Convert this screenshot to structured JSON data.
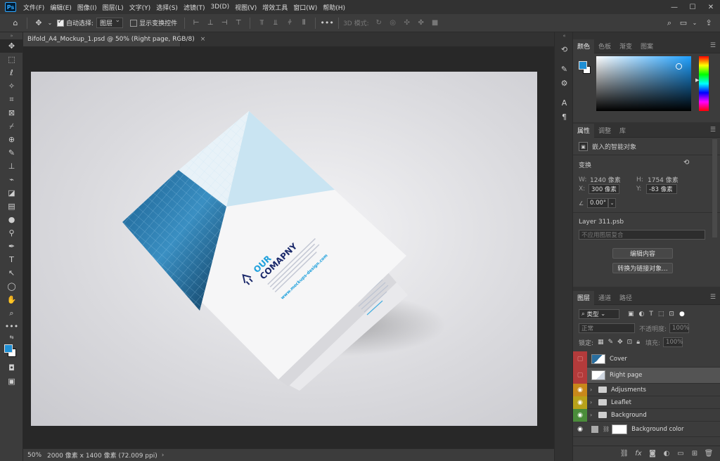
{
  "app": {
    "logo": "Ps",
    "menus": [
      "文件(F)",
      "编辑(E)",
      "图像(I)",
      "图层(L)",
      "文字(Y)",
      "选择(S)",
      "滤镜(T)",
      "3D(D)",
      "视图(V)",
      "增效工具",
      "窗口(W)",
      "帮助(H)"
    ],
    "window_controls": [
      "—",
      "☐",
      "✕"
    ]
  },
  "options_bar": {
    "auto_select_label": "自动选择:",
    "auto_select_target": "图层",
    "show_transform_label": "显示变换控件",
    "mode_3d_label": "3D 模式:"
  },
  "document": {
    "tab_title": "Bifold_A4_Mockup_1.psd @ 50% (Right page, RGB/8)",
    "close_glyph": "×",
    "status_zoom": "50%",
    "status_info": "2000 像素 x 1400 像素 (72.009 ppi)",
    "status_arrow": "›"
  },
  "artwork": {
    "headline_1": "OUR",
    "headline_2": "COMAPNY",
    "website": "www.mockups-design.com",
    "accent": "#1ea0dc",
    "navy": "#1c2a6b"
  },
  "color_panel": {
    "tabs": [
      "颜色",
      "色板",
      "渐变",
      "图案"
    ],
    "foreground": "#1e8fd4",
    "background": "#ffffff",
    "hue": "#1ea0ff"
  },
  "properties_panel": {
    "tabs": [
      "属性",
      "调整",
      "库"
    ],
    "object_type": "嵌入的智能对象",
    "transform_label": "变换",
    "w_label": "W:",
    "w_value": "1240 像素",
    "h_label": "H:",
    "h_value": "1754 像素",
    "x_label": "X:",
    "x_value": "300 像素",
    "y_label": "Y:",
    "y_value": "-83 像素",
    "angle_value": "0.00°",
    "source_name": "Layer 311.psb",
    "comp_placeholder": "不应用图层复合",
    "edit_contents_label": "编辑内容",
    "convert_linked_label": "转换为链接对象..."
  },
  "layers_panel": {
    "tabs": [
      "图层",
      "通道",
      "路径"
    ],
    "filter_kind": "类型",
    "blend_mode": "正常",
    "opacity_label": "不透明度:",
    "opacity_value": "100%",
    "lock_label": "锁定:",
    "fill_label": "填充:",
    "fill_value": "100%",
    "layers": [
      {
        "name": "Cover",
        "color": "#b33b3b",
        "type": "smart",
        "visible": false
      },
      {
        "name": "Right page",
        "color": "#b33b3b",
        "type": "smart",
        "visible": false,
        "selected": true
      },
      {
        "name": "Adjusments",
        "color": "#c8881a",
        "type": "group",
        "visible": true
      },
      {
        "name": "Leaflet",
        "color": "#b8a21a",
        "type": "group",
        "visible": true
      },
      {
        "name": "Background",
        "color": "#4a8c3a",
        "type": "group",
        "visible": true
      },
      {
        "name": "Background color",
        "color": "#3c3c3c",
        "type": "fill",
        "visible": true
      }
    ]
  }
}
